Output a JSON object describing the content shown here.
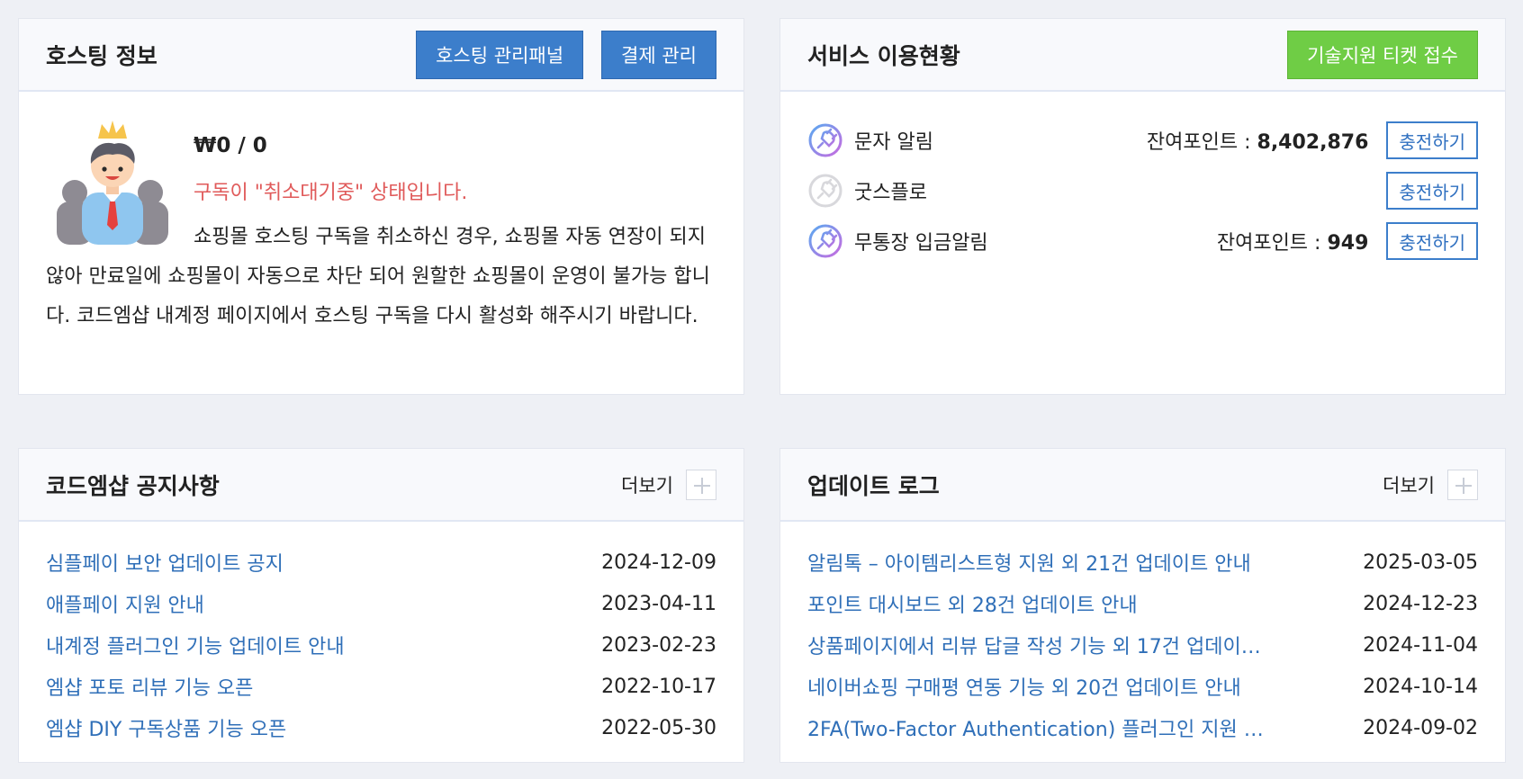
{
  "hosting": {
    "title": "호스팅 정보",
    "manage_panel_label": "호스팅 관리패널",
    "billing_label": "결제 관리",
    "price": "₩0 / 0",
    "warning": "구독이 \"취소대기중\" 상태입니다.",
    "description": "쇼핑몰 호스팅 구독을 취소하신 경우, 쇼핑몰 자동 연장이 되지 않아 만료일에 쇼핑몰이 자동으로 차단 되어 원할한 쇼핑몰이 운영이 불가능 합니다. 코드엠샵 내계정 페이지에서 호스팅 구독을 다시 활성화 해주시기 바랍니다."
  },
  "service": {
    "title": "서비스 이용현황",
    "ticket_label": "기술지원 티켓 접수",
    "items": [
      {
        "name": "문자 알림",
        "points_label": "잔여포인트 : ",
        "points": "8,402,876",
        "charge_label": "충전하기",
        "active": true
      },
      {
        "name": "굿스플로",
        "points_label": "",
        "points": "",
        "charge_label": "충전하기",
        "active": false
      },
      {
        "name": "무통장 입금알림",
        "points_label": "잔여포인트 : ",
        "points": "949",
        "charge_label": "충전하기",
        "active": true
      }
    ]
  },
  "notice": {
    "title": "코드엠샵 공지사항",
    "more_label": "더보기",
    "items": [
      {
        "title": "심플페이 보안 업데이트 공지",
        "date": "2024-12-09"
      },
      {
        "title": "애플페이 지원 안내",
        "date": "2023-04-11"
      },
      {
        "title": "내계정 플러그인 기능 업데이트 안내",
        "date": "2023-02-23"
      },
      {
        "title": "엠샵 포토 리뷰 기능 오픈",
        "date": "2022-10-17"
      },
      {
        "title": "엠샵 DIY 구독상품 기능 오픈",
        "date": "2022-05-30"
      }
    ]
  },
  "update": {
    "title": "업데이트 로그",
    "more_label": "더보기",
    "items": [
      {
        "title": "알림톡 – 아이템리스트형 지원 외 21건 업데이트 안내",
        "date": "2025-03-05"
      },
      {
        "title": "포인트 대시보드 외 28건 업데이트 안내",
        "date": "2024-12-23"
      },
      {
        "title": "상품페이지에서 리뷰 답글 작성 기능 외 17건 업데이…",
        "date": "2024-11-04"
      },
      {
        "title": "네이버쇼핑 구매평 연동 기능 외 20건 업데이트 안내",
        "date": "2024-10-14"
      },
      {
        "title": "2FA(Two-Factor Authentication) 플러그인 지원 …",
        "date": "2024-09-02"
      }
    ]
  },
  "colors": {
    "primary_blue": "#3c7ecb",
    "ticket_green": "#6fcd45",
    "warning_red": "#e05a5a",
    "link_blue": "#2f6fb8",
    "background": "#eef0f5"
  },
  "icons": {
    "avatar": "user-avatar-crown-icon",
    "service_active": "plug-gradient-icon",
    "service_inactive": "plug-gray-icon",
    "more": "plus-icon"
  }
}
